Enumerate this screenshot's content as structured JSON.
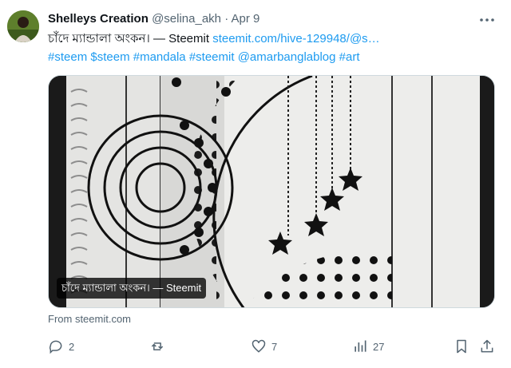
{
  "tweet": {
    "display_name": "Shelleys Creation",
    "handle": "@selina_akh",
    "separator": "·",
    "date": "Apr 9",
    "text_main": "চাঁদে ম্যান্ডালা অংকন। — Steemit",
    "link_text": "steemit.com/hive-129948/@s…",
    "hashtags": [
      "#steem",
      "$steem",
      "#mandala",
      "#steemit",
      "@amarbanglablog",
      "#art"
    ]
  },
  "media": {
    "caption": "চাঁদে ম্যান্ডালা অংকন। — Steemit",
    "source": "From steemit.com"
  },
  "actions": {
    "replies": "2",
    "reposts": "",
    "likes": "7",
    "views": "27"
  },
  "colors": {
    "link": "#1d9bf0",
    "muted": "#536471",
    "text": "#0f1419"
  }
}
